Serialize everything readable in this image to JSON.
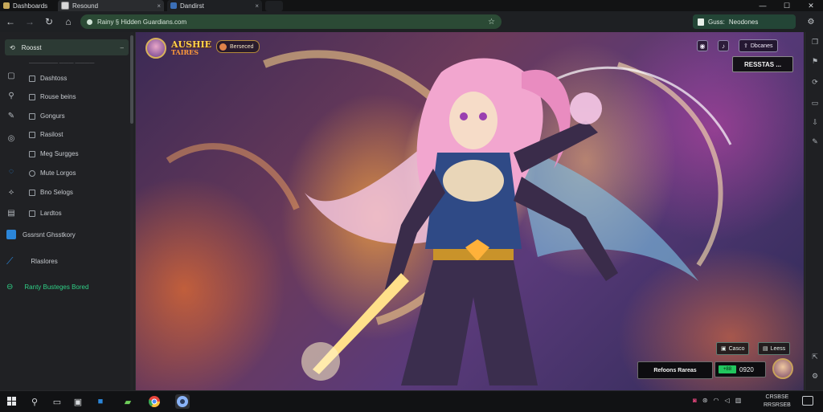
{
  "browser": {
    "tabs": [
      {
        "label": "Dashboards"
      },
      {
        "label": "Resound",
        "close": "×"
      },
      {
        "label": "Dandirst",
        "close": "×"
      }
    ],
    "window_controls": {
      "minimize": "—",
      "maximize": "☐",
      "close": "✕"
    },
    "address": {
      "url": "Rainy § Hidden Guardians.com"
    },
    "profile": {
      "label": "Guss:",
      "value": "Neodones"
    }
  },
  "sidebar": {
    "header": "Roosst",
    "sub": "—————— ——— ————",
    "items": [
      {
        "label": "Dashtoss"
      },
      {
        "label": "Rouse beins"
      },
      {
        "label": "Gongurs"
      },
      {
        "label": "Rasilost"
      },
      {
        "label": "Meg Surgges"
      },
      {
        "label": "Mute Lorgos"
      },
      {
        "label": "Bno Selogs"
      },
      {
        "label": "Lardtos"
      }
    ],
    "wide_items": [
      {
        "label": "Gssrsnt Ghsstkory"
      },
      {
        "label": "Rlaslores"
      },
      {
        "label": "Ranty Busteges Bored"
      }
    ]
  },
  "game": {
    "logo": {
      "line1": "AUSHIE",
      "line2": "TAIRES"
    },
    "pill": "Berseced",
    "share": "Dbcanes",
    "main_button": "RESSTAS ...",
    "small_buttons": [
      {
        "label": "Casco"
      },
      {
        "label": "Leess"
      }
    ],
    "bottom_label": "Refoons Rareas",
    "score_badge": "+88",
    "score_value": "0920"
  },
  "taskbar": {
    "clock": {
      "line1": "CRSBSE",
      "line2": "RRSRSEB"
    }
  },
  "colors": {
    "address_bg": "#2b4a35",
    "accent_green": "#2fcf86",
    "accent_blue": "#2b86d9",
    "score_green": "#22c55e"
  }
}
